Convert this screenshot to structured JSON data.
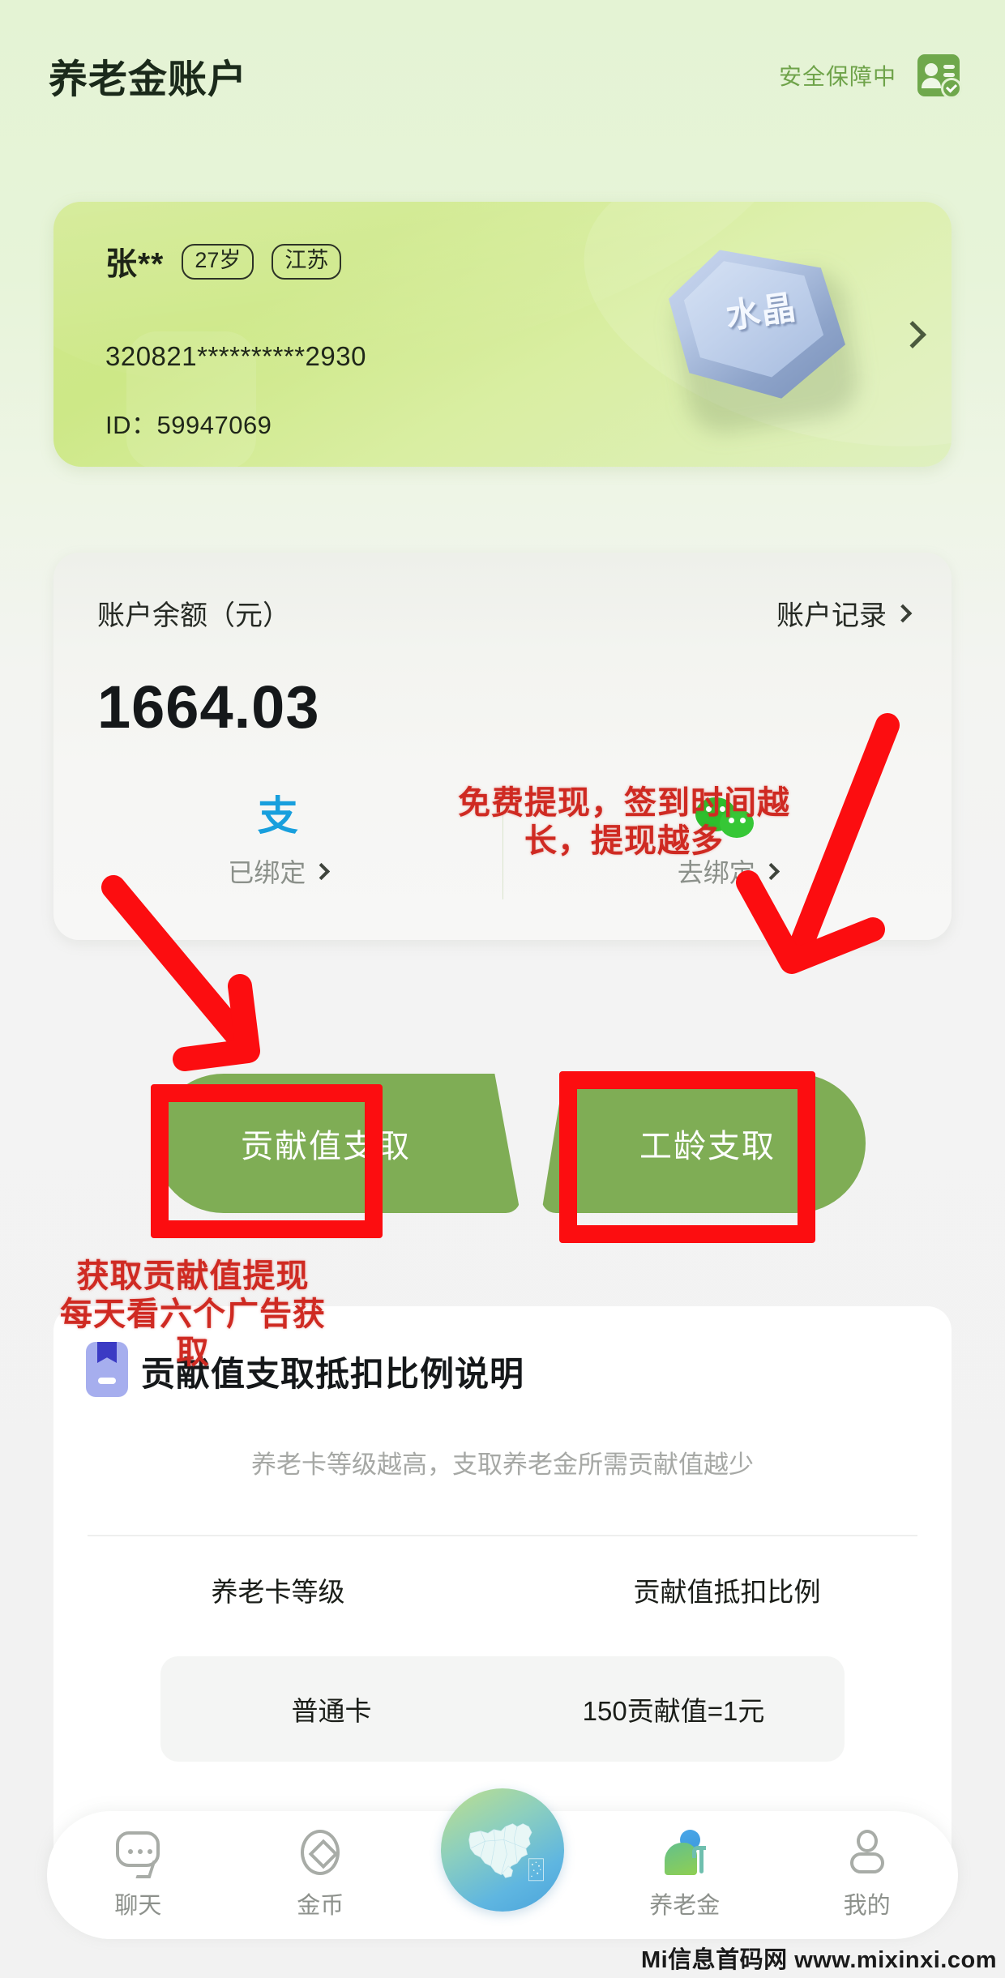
{
  "header": {
    "title": "养老金账户",
    "secure_text": "安全保障中",
    "badge_icon": "id-card-verified-icon"
  },
  "profile": {
    "name": "张**",
    "age_tag": "27岁",
    "region_tag": "江苏",
    "id_number": "320821**********2930",
    "user_id": "ID：59947069",
    "badge_label": "水晶",
    "chevron_icon": "chevron-right-icon"
  },
  "balance": {
    "label": "账户余额（元）",
    "record_link": "账户记录",
    "amount": "1664.03",
    "alipay": {
      "logo": "支",
      "status": "已绑定"
    },
    "wechat": {
      "logo": "wechat-icon",
      "status": "去绑定"
    }
  },
  "actions": {
    "contribution_withdraw": "贡献值支取",
    "seniority_withdraw": "工龄支取"
  },
  "info": {
    "title": "贡献值支取抵扣比例说明",
    "subtitle": "养老卡等级越高，支取养老金所需贡献值越少",
    "icon": "card-bookmark-icon",
    "table": {
      "headers": [
        "养老卡等级",
        "贡献值抵扣比例"
      ],
      "rows": [
        [
          "普通卡",
          "150贡献值=1元"
        ]
      ]
    }
  },
  "annotations": {
    "withdraw_note": "免费提现，签到时间越\n长，提现越多",
    "contribution_note": "获取贡献值提现\n每天看六个广告获\n取",
    "color": "#cf2a22",
    "box_color": "#fc0d10"
  },
  "nav": {
    "items": [
      {
        "label": "聊天",
        "icon": "chat-bubble-icon",
        "active": false
      },
      {
        "label": "金币",
        "icon": "coin-diamond-icon",
        "active": false
      },
      {
        "label": "养老金",
        "icon": "elderly-person-icon",
        "active": true
      },
      {
        "label": "我的",
        "icon": "user-profile-icon",
        "active": false
      }
    ],
    "center": {
      "icon": "china-map-icon"
    }
  },
  "watermark": "Mi信息首码网  www.mixinxi.com",
  "colors": {
    "brand_green": "#7fad55",
    "header_green": "#6fa34a",
    "accent_red": "#fc0d10",
    "alipay_blue": "#189fdd",
    "wechat_green": "#2dbf2d"
  }
}
